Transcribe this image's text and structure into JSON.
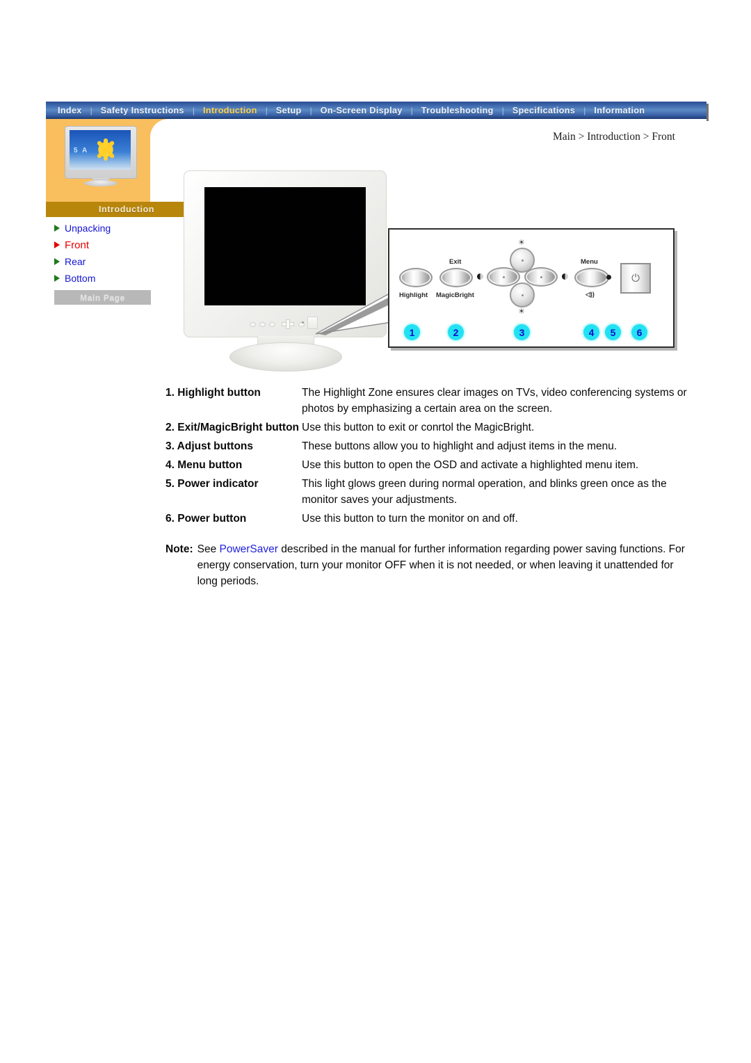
{
  "nav": {
    "separator": "|",
    "items": [
      {
        "label": "Index",
        "active": false
      },
      {
        "label": "Safety Instructions",
        "active": false
      },
      {
        "label": "Introduction",
        "active": true
      },
      {
        "label": "Setup",
        "active": false
      },
      {
        "label": "On-Screen Display",
        "active": false
      },
      {
        "label": "Troubleshooting",
        "active": false
      },
      {
        "label": "Specifications",
        "active": false
      },
      {
        "label": "Information",
        "active": false
      }
    ]
  },
  "sidebar": {
    "thumbnail_text": "5 A",
    "caption": "Introduction",
    "links": [
      {
        "label": "Unpacking",
        "current": false
      },
      {
        "label": "Front",
        "current": true
      },
      {
        "label": "Rear",
        "current": false
      },
      {
        "label": "Bottom",
        "current": false
      }
    ],
    "main_page_button": "Main Page"
  },
  "breadcrumb": "Main > Introduction > Front",
  "panel": {
    "labels": {
      "highlight": "Highlight",
      "exit": "Exit",
      "magicbright": "MagicBright",
      "menu": "Menu",
      "brightness_up": "☀",
      "brightness_down": "☀",
      "volume": "◁))"
    },
    "power_glyph": "⏻",
    "numbers": [
      "1",
      "2",
      "3",
      "4",
      "5",
      "6"
    ]
  },
  "descriptions": [
    {
      "term": "1. Highlight button",
      "definition": "The Highlight Zone ensures clear images on TVs, video conferencing systems or photos by emphasizing a certain area on the screen."
    },
    {
      "term": "2. Exit/MagicBright button",
      "definition": "Use this button to exit or conrtol the MagicBright."
    },
    {
      "term": "3. Adjust buttons",
      "definition": "These buttons allow you to highlight and adjust items in the menu."
    },
    {
      "term": "4. Menu button",
      "definition": "Use this button to open the OSD and activate a highlighted menu item."
    },
    {
      "term": "5. Power indicator",
      "definition": "This light glows green during normal operation, and blinks green once as the monitor saves your adjustments."
    },
    {
      "term": "6. Power button",
      "definition": "Use this button to turn the monitor on and off."
    }
  ],
  "note": {
    "label": "Note:",
    "text_before": "See ",
    "link": "PowerSaver",
    "text_after": " described in the manual for further information regarding power saving functions. For energy conservation, turn your monitor OFF when it is not needed, or when leaving it unattended for long periods."
  },
  "colors": {
    "nav_bar_blue": "#3a62a8",
    "nav_active_yellow": "#ffd24d",
    "sidebar_orange": "#f9bf5e",
    "caption_brown": "#b8860b",
    "link_blue": "#1414d2",
    "current_red": "#e60000",
    "arrow_green": "#1d7a1d",
    "badge_cyan": "#22e2f2",
    "badge_number_blue": "#0d0dcf"
  }
}
